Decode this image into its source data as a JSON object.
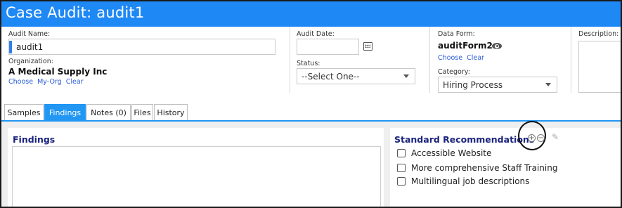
{
  "window": {
    "title": "Case Audit: audit1"
  },
  "audit_name": {
    "label": "Audit Name:",
    "value": "audit1"
  },
  "organization": {
    "label": "Organization:",
    "value": "A Medical Supply Inc",
    "links": [
      "Choose",
      "My-Org",
      "Clear"
    ]
  },
  "audit_date": {
    "label": "Audit Date:",
    "value": ""
  },
  "status": {
    "label": "Status:",
    "selected": "--Select One--"
  },
  "data_form": {
    "label": "Data Form:",
    "value": "auditForm2",
    "links": [
      "Choose",
      "Clear"
    ]
  },
  "category": {
    "label": "Category:",
    "selected": "Hiring Process"
  },
  "description": {
    "label": "Description:"
  },
  "tabs": [
    {
      "label": "Samples",
      "active": false
    },
    {
      "label": "Findings",
      "active": true
    },
    {
      "label": "Notes (0)",
      "active": false
    },
    {
      "label": "Files",
      "active": false
    },
    {
      "label": "History",
      "active": false
    }
  ],
  "findings": {
    "title": "Findings"
  },
  "recommendations": {
    "title": "Standard Recommendations",
    "add_glyph": "+",
    "remove_glyph": "−",
    "edit_glyph": "✎",
    "items": [
      {
        "label": "Accessible Website",
        "checked": false
      },
      {
        "label": "More comprehensive Staff Training",
        "checked": false
      },
      {
        "label": "Multilingual job descriptions",
        "checked": false
      }
    ]
  },
  "colors": {
    "accent": "#1e88f5",
    "tab_active": "#2196f3",
    "link": "#2a5bd7",
    "heading": "#1a237e"
  }
}
